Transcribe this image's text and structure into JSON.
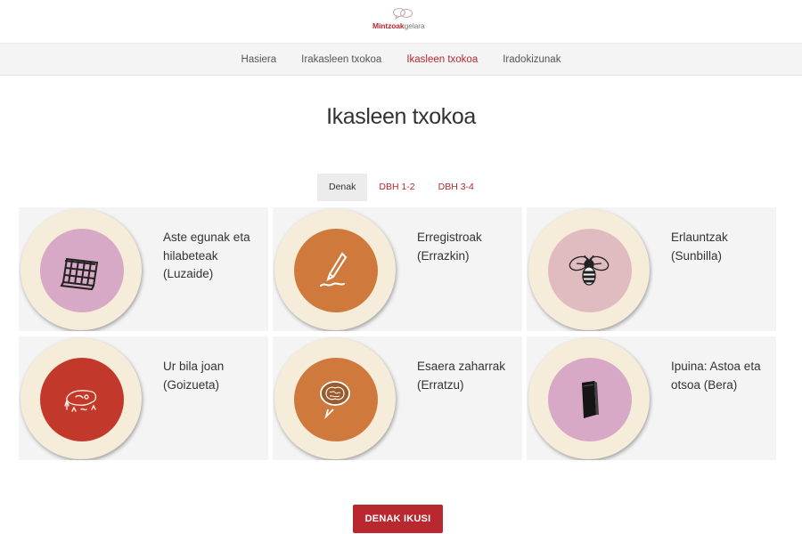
{
  "brand": {
    "part1": "Mintzoak",
    "part2": "gelara"
  },
  "nav": {
    "items": [
      "Hasiera",
      "Irakasleen txokoa",
      "Ikasleen txokoa",
      "Iradokizunak"
    ],
    "active_index": 2
  },
  "page": {
    "title": "Ikasleen txokoa"
  },
  "filters": {
    "items": [
      "Denak",
      "DBH 1-2",
      "DBH 3-4"
    ],
    "active_index": 0
  },
  "cards": [
    {
      "title": "Aste egunak eta hilabeteak (Luzaide)",
      "icon": "calendar-icon",
      "blob_color": "#d8a9c6"
    },
    {
      "title": "Erregistroak (Errazkin)",
      "icon": "pencil-icon",
      "blob_color": "#cf7a3c"
    },
    {
      "title": "Erlauntzak (Sunbilla)",
      "icon": "bee-icon",
      "blob_color": "#e0bcc0"
    },
    {
      "title": "Ur bila joan (Goizueta)",
      "icon": "map-icon",
      "blob_color": "#c2382a"
    },
    {
      "title": "Esaera zaharrak (Erratzu)",
      "icon": "brain-speech-icon",
      "blob_color": "#cf7a3c"
    },
    {
      "title": "Ipuina: Astoa eta otsoa (Bera)",
      "icon": "book-icon",
      "blob_color": "#d8a9c6"
    }
  ],
  "footer": {
    "button_label": "DENAK IKUSI"
  },
  "colors": {
    "accent": "#b8282e",
    "plate": "#f5ecd9",
    "card_bg": "#f4f4f4"
  }
}
